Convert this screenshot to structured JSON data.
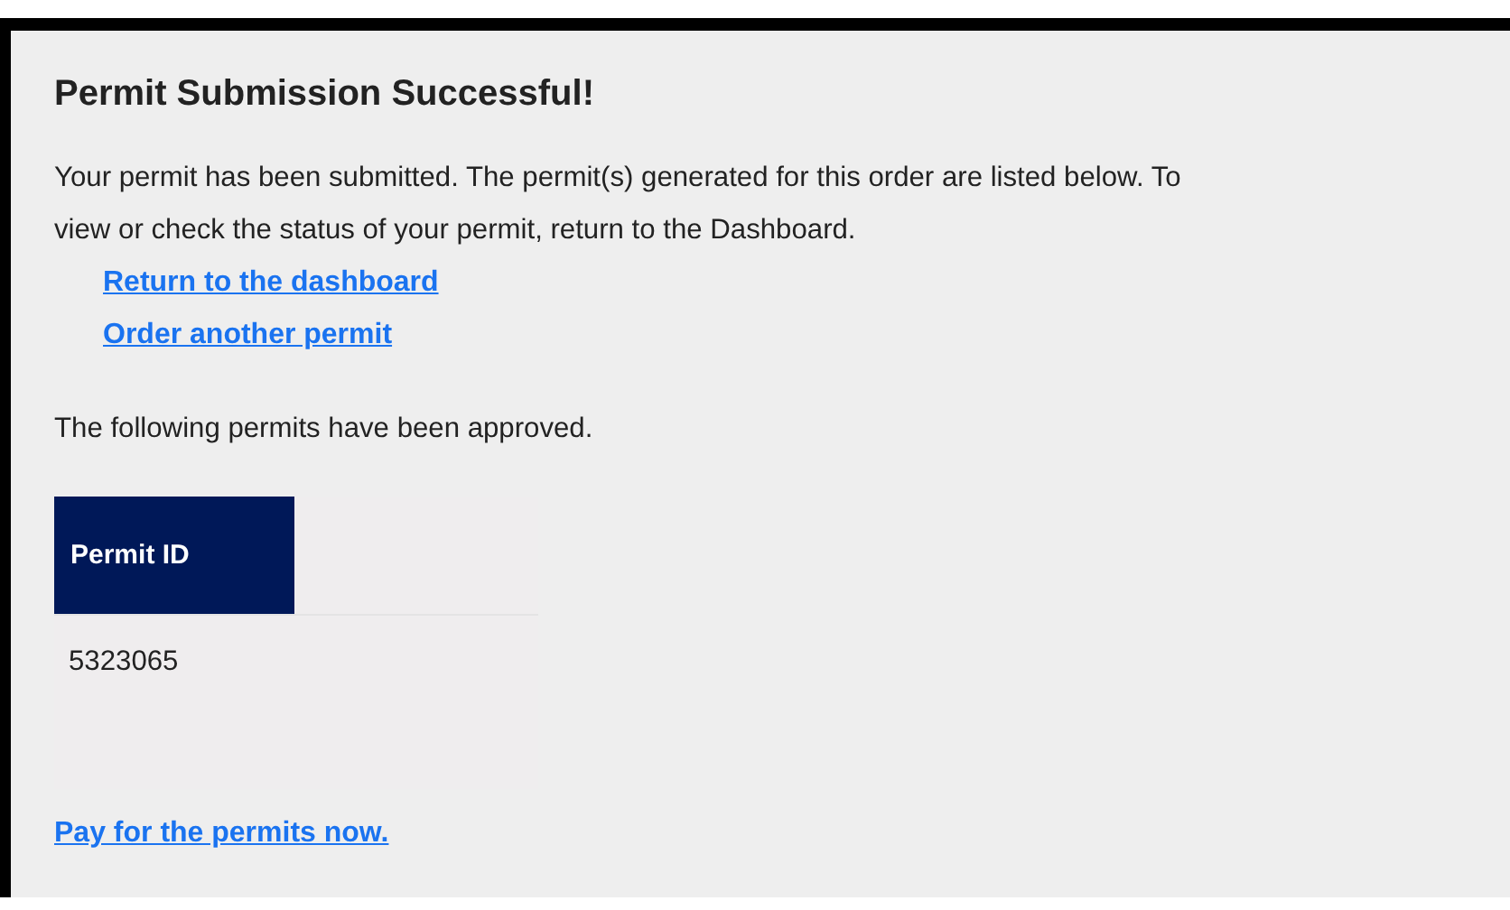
{
  "title": "Permit Submission Successful!",
  "message_lines": [
    "Your permit has been submitted. The permit(s) generated for this order are listed below. To",
    "view or check the status of your permit, return to the Dashboard."
  ],
  "links": [
    "Return to the dashboard",
    "Order another permit"
  ],
  "approved_text": "The following permits have been approved.",
  "table": {
    "columns": [
      "Permit ID"
    ],
    "rows": [
      [
        "5323065"
      ]
    ]
  },
  "pay_link": "Pay for the permits now."
}
